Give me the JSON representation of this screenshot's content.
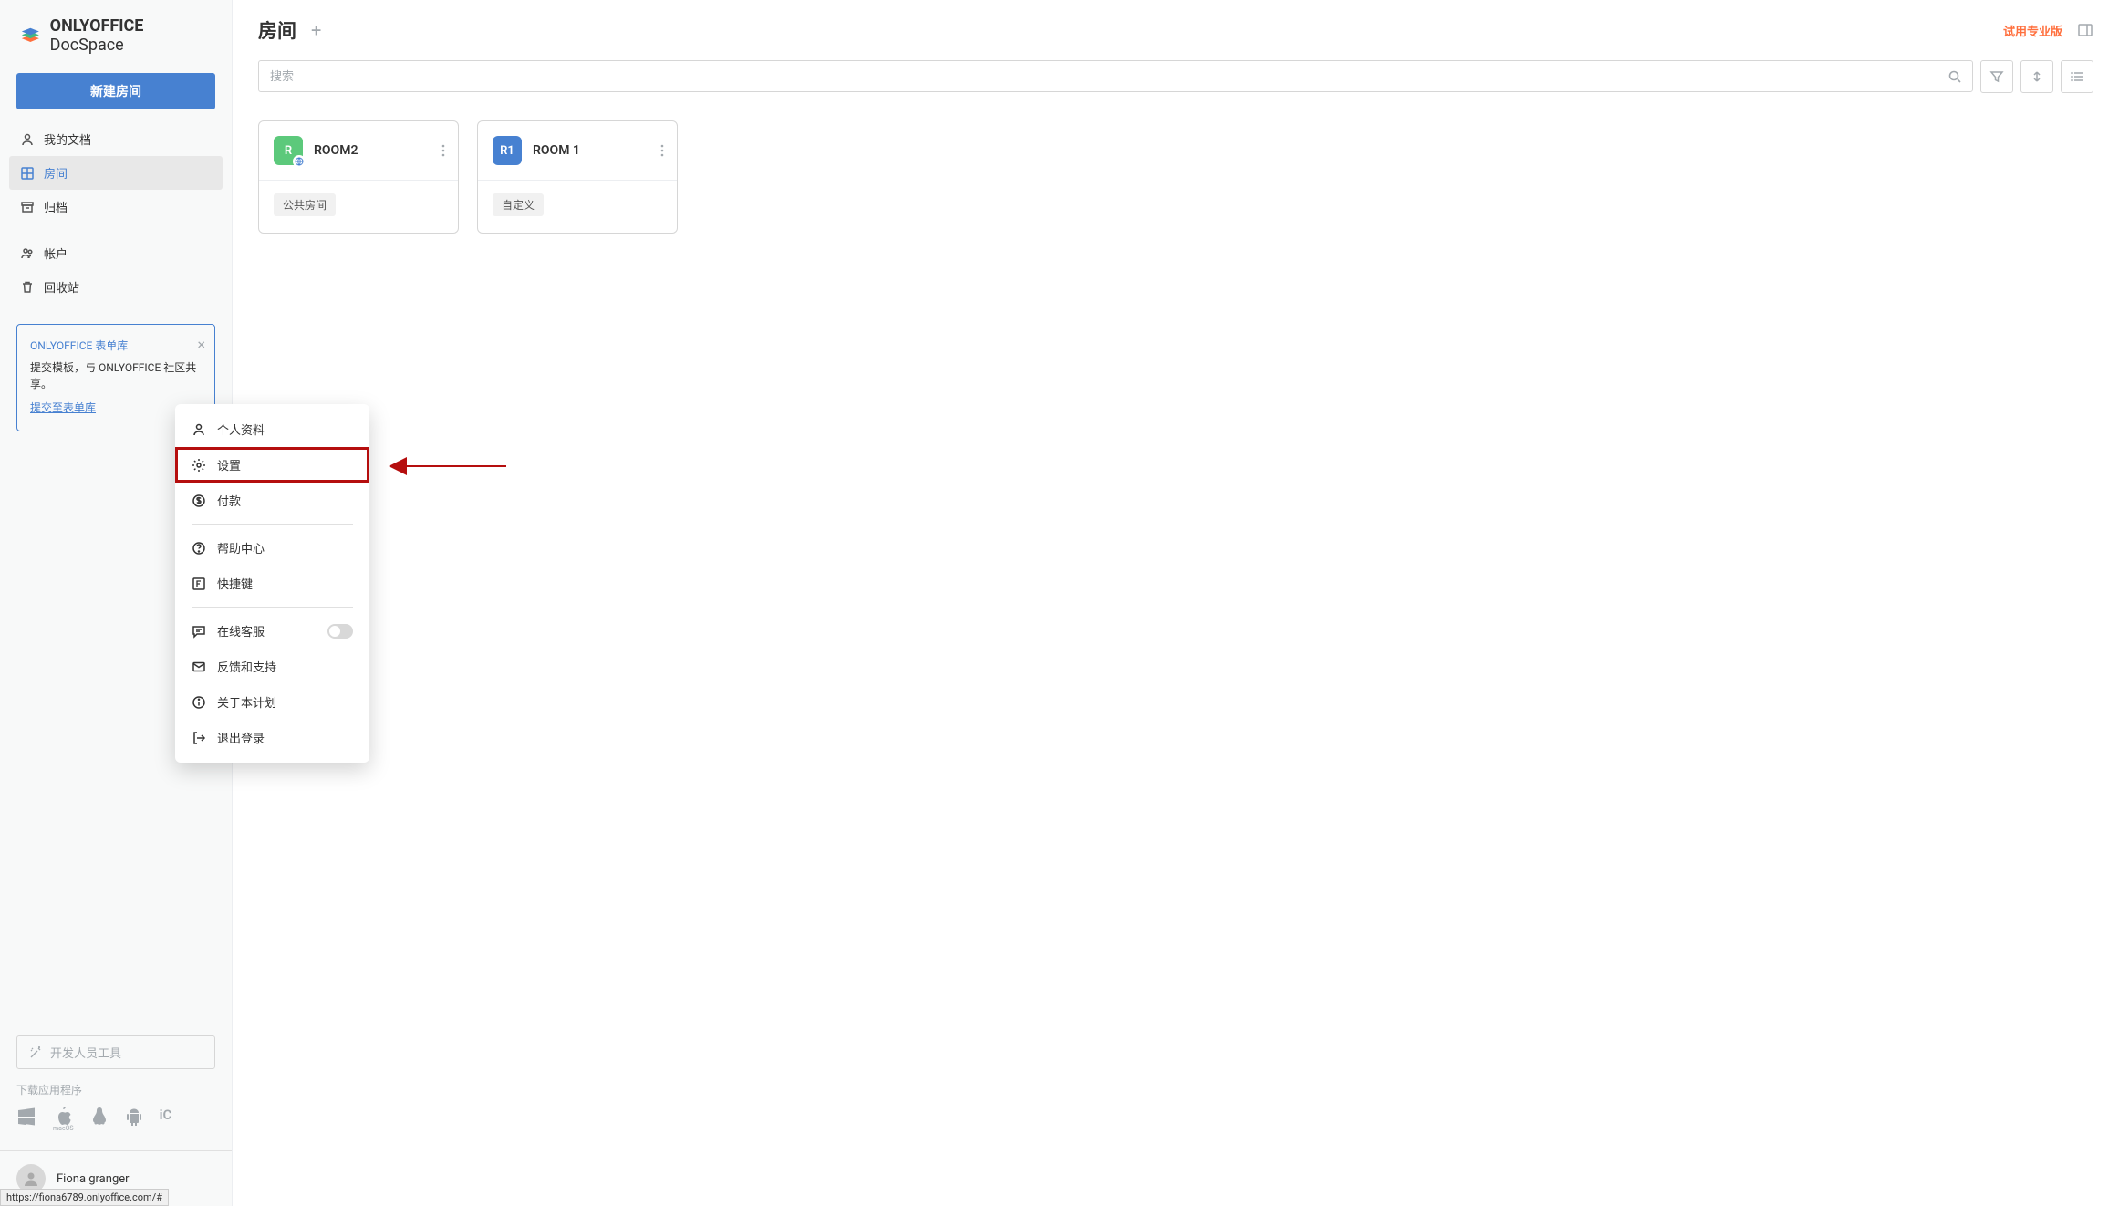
{
  "logo": {
    "brand": "ONLYOFFICE",
    "product": "DocSpace"
  },
  "sidebar": {
    "new_room_label": "新建房间",
    "nav": [
      {
        "label": "我的文档"
      },
      {
        "label": "房间"
      },
      {
        "label": "归档"
      },
      {
        "label": "帐户"
      },
      {
        "label": "回收站"
      }
    ],
    "promo": {
      "title": "ONLYOFFICE 表单库",
      "body": "提交模板，与 ONLYOFFICE 社区共享。",
      "link": "提交至表单库"
    },
    "dev_tools": "开发人员工具",
    "download_label": "下载应用程序",
    "user_name": "Fiona granger"
  },
  "header": {
    "title": "房间",
    "trial_link": "试用专业版"
  },
  "search": {
    "placeholder": "搜索"
  },
  "rooms": [
    {
      "badge": "R",
      "name": "ROOM2",
      "tag": "公共房间",
      "color": "green",
      "public": true
    },
    {
      "badge": "R1",
      "name": "ROOM 1",
      "tag": "自定义",
      "color": "blue",
      "public": false
    }
  ],
  "popup": {
    "items": [
      {
        "label": "个人资料",
        "icon": "user"
      },
      {
        "label": "设置",
        "icon": "gear",
        "highlighted": true
      },
      {
        "label": "付款",
        "icon": "dollar"
      },
      {
        "label": "帮助中心",
        "icon": "help"
      },
      {
        "label": "快捷键",
        "icon": "f-key"
      },
      {
        "label": "在线客服",
        "icon": "chat",
        "toggle": true
      },
      {
        "label": "反馈和支持",
        "icon": "mail"
      },
      {
        "label": "关于本计划",
        "icon": "info"
      },
      {
        "label": "退出登录",
        "icon": "logout"
      }
    ]
  },
  "status_url": "https://fiona6789.onlyoffice.com/#"
}
